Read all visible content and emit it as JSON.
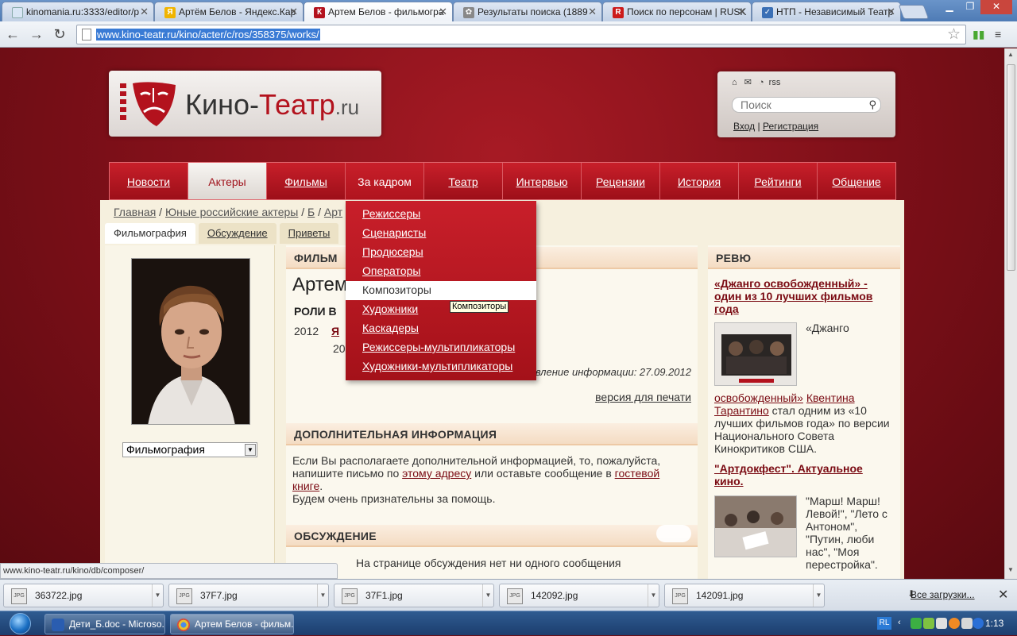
{
  "browser": {
    "tabs": [
      {
        "title": "kinomania.ru:3333/editor/p",
        "fav_color": "#d9e6f5",
        "fav_glyph": ""
      },
      {
        "title": "Артём Белов - Яндекс.Кар",
        "fav_color": "#f0b400",
        "fav_glyph": "Я"
      },
      {
        "title": "Артем Белов - фильмогра",
        "fav_color": "#b3121d",
        "fav_glyph": "К"
      },
      {
        "title": "Результаты поиска (1889",
        "fav_color": "#888888",
        "fav_glyph": "✿"
      },
      {
        "title": "Поиск по персонам | RUSK",
        "fav_color": "#cc1b1b",
        "fav_glyph": "R"
      },
      {
        "title": "НТП - Независимый Театр",
        "fav_color": "#3a6fb5",
        "fav_glyph": "✓"
      }
    ],
    "url": "www.kino-teatr.ru/kino/acter/c/ros/358375/works/",
    "status_url": "www.kino-teatr.ru/kino/db/composer/"
  },
  "site": {
    "logo_text_1": "Кино-",
    "logo_text_2": "Театр",
    "logo_text_3": ".ru",
    "rss": "rss",
    "search_placeholder": "Поиск",
    "login": "Вход",
    "separator": "|",
    "register": "Регистрация"
  },
  "nav": {
    "items": [
      "Новости",
      "Актеры",
      "Фильмы",
      "За кадром",
      "Театр",
      "Интервью",
      "Рецензии",
      "История",
      "Рейтинги",
      "Общение"
    ]
  },
  "dropdown": {
    "items": [
      "Режиссеры",
      "Сценаристы",
      "Продюсеры",
      "Операторы",
      "Композиторы",
      "Художники",
      "Каскадеры",
      "Режиссеры-мультипликаторы",
      "Художники-мультипликаторы"
    ],
    "hovered": "Композиторы",
    "tooltip": "Композиторы"
  },
  "breadcrumb": {
    "home": "Главная",
    "sep1": " / ",
    "section": "Юные российские актеры",
    "sep2": " / ",
    "letter": "Б",
    "sep3": " / ",
    "current": "Арт"
  },
  "subtabs": [
    "Фильмография",
    "Обсуждение",
    "Приветы"
  ],
  "left": {
    "select_value": "Фильмография"
  },
  "center": {
    "filmography_head": "ФИЛЬМ",
    "actor_name": "Артем",
    "roles_head": "РОЛИ В",
    "role_year": "2012",
    "role_title": "Я",
    "role_year2": "20",
    "updated": "Последнее обновление информации: 27.09.2012",
    "print_link": "версия для печати",
    "more_info_head": "ДОПОЛНИТЕЛЬНАЯ ИНФОРМАЦИЯ",
    "more_info_1": "Если Вы располагаете дополнительной информацией, то, пожалуйста, напишите письмо по ",
    "more_info_link1": "этому адресу",
    "more_info_2": " или оставьте сообщение в ",
    "more_info_link2": "гостевой книге",
    "more_info_3": ".",
    "more_info_4": "Будем очень признательны за помощь.",
    "discussion_head": "ОБСУЖДЕНИЕ",
    "no_comments": "На странице обсуждения нет ни одного сообщения"
  },
  "right": {
    "head": "РЕВЮ",
    "review1_title": "«Джанго освобожденный» - один из 10 лучших фильмов года",
    "review1_link_a": "«Джанго",
    "review1_link_b": "освобожденный»",
    "review1_author": "Квентина Тарантино",
    "review1_text": " стал одним из «10 лучших фильмов года» по версии Национального Совета Кинокритиков США.",
    "review2_title": "\"Артдокфест\". Актуальное кино.",
    "review2_text": "\"Марш! Марш! Левой!\", \"Лето с Антоном\", \"Путин, люби нас\", \"Моя перестройка\"."
  },
  "downloads": {
    "items": [
      "363722.jpg",
      "37F7.jpg",
      "37F1.jpg",
      "142092.jpg",
      "142091.jpg"
    ],
    "all": "Все загрузки...",
    "file_badge": "JPG"
  },
  "taskbar": {
    "tasks": [
      "Дети_Б.doc - Microso...",
      "Артем Белов - фильм..."
    ],
    "lang": "RL",
    "clock": "1:13"
  }
}
